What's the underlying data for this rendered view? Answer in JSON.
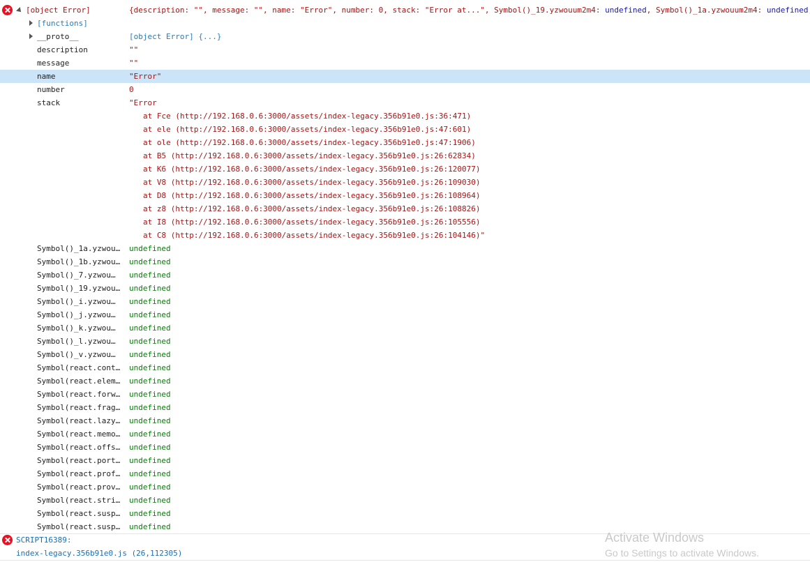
{
  "error": {
    "label": "[object Error]",
    "summary_pre": "{description: \"\", message: \"\", name: \"Error\", number: 0, stack: \"Error at...\", Symbol()_19.yzwouum2m4: ",
    "summary_undef1": "undefined",
    "summary_mid": ", Symbol()_1a.yzwouum2m4: ",
    "summary_undef2": "undefined",
    "summary_end": ","
  },
  "functions_label": "[functions]",
  "proto": {
    "key": "__proto__",
    "value": "[object Error] {...}"
  },
  "props": {
    "description": {
      "key": "description",
      "value": "\"\""
    },
    "message": {
      "key": "message",
      "value": "\"\""
    },
    "name": {
      "key": "name",
      "value": "\"Error\""
    },
    "number": {
      "key": "number",
      "value": "0"
    },
    "stack": {
      "key": "stack",
      "value": "\"Error"
    }
  },
  "stack_lines": [
    "at Fce (http://192.168.0.6:3000/assets/index-legacy.356b91e0.js:36:471)",
    "at ele (http://192.168.0.6:3000/assets/index-legacy.356b91e0.js:47:601)",
    "at ole (http://192.168.0.6:3000/assets/index-legacy.356b91e0.js:47:1906)",
    "at B5 (http://192.168.0.6:3000/assets/index-legacy.356b91e0.js:26:62834)",
    "at K6 (http://192.168.0.6:3000/assets/index-legacy.356b91e0.js:26:120077)",
    "at V8 (http://192.168.0.6:3000/assets/index-legacy.356b91e0.js:26:109030)",
    "at D8 (http://192.168.0.6:3000/assets/index-legacy.356b91e0.js:26:108964)",
    "at z8 (http://192.168.0.6:3000/assets/index-legacy.356b91e0.js:26:108826)",
    "at I8 (http://192.168.0.6:3000/assets/index-legacy.356b91e0.js:26:105556)",
    "at C8 (http://192.168.0.6:3000/assets/index-legacy.356b91e0.js:26:104146)\""
  ],
  "symbols": [
    {
      "key": "Symbol()_1a.yzwou…",
      "value": "undefined"
    },
    {
      "key": "Symbol()_1b.yzwou…",
      "value": "undefined"
    },
    {
      "key": "Symbol()_7.yzwou…",
      "value": "undefined"
    },
    {
      "key": "Symbol()_19.yzwou…",
      "value": "undefined"
    },
    {
      "key": "Symbol()_i.yzwou…",
      "value": "undefined"
    },
    {
      "key": "Symbol()_j.yzwou…",
      "value": "undefined"
    },
    {
      "key": "Symbol()_k.yzwou…",
      "value": "undefined"
    },
    {
      "key": "Symbol()_l.yzwou…",
      "value": "undefined"
    },
    {
      "key": "Symbol()_v.yzwou…",
      "value": "undefined"
    },
    {
      "key": "Symbol(react.cont…",
      "value": "undefined"
    },
    {
      "key": "Symbol(react.elem…",
      "value": "undefined"
    },
    {
      "key": "Symbol(react.forw…",
      "value": "undefined"
    },
    {
      "key": "Symbol(react.frag…",
      "value": "undefined"
    },
    {
      "key": "Symbol(react.lazy…",
      "value": "undefined"
    },
    {
      "key": "Symbol(react.memo…",
      "value": "undefined"
    },
    {
      "key": "Symbol(react.offs…",
      "value": "undefined"
    },
    {
      "key": "Symbol(react.port…",
      "value": "undefined"
    },
    {
      "key": "Symbol(react.prof…",
      "value": "undefined"
    },
    {
      "key": "Symbol(react.prov…",
      "value": "undefined"
    },
    {
      "key": "Symbol(react.stri…",
      "value": "undefined"
    },
    {
      "key": "Symbol(react.susp…",
      "value": "undefined"
    },
    {
      "key": "Symbol(react.susp…",
      "value": "undefined"
    }
  ],
  "script_error": {
    "code": "SCRIPT16389:",
    "location": "index-legacy.356b91e0.js (26,112305)"
  },
  "watermark": {
    "title": "Activate Windows",
    "subtitle": "Go to Settings to activate Windows."
  },
  "colors": {
    "selected_row": "#cce4f7",
    "error_icon": "#e81123",
    "string": "#a31515",
    "undefined": "#0b7a0b"
  }
}
